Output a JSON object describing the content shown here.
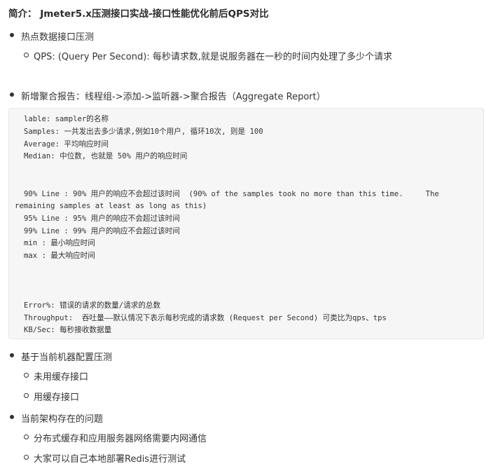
{
  "title": "简介： Jmeter5.x压测接口实战-接口性能优化前后QPS对比",
  "sections": [
    {
      "label": "热点数据接口压测",
      "children": [
        "QPS: (Query Per Second): 每秒请求数,就是说服务器在一秒的时间内处理了多少个请求"
      ]
    },
    {
      "label": "新增聚合报告：线程组->添加->监听器->聚合报告（Aggregate Report）",
      "children": []
    },
    {
      "label": "基于当前机器配置压测",
      "children": [
        "未用缓存接口",
        "用缓存接口"
      ]
    },
    {
      "label": "当前架构存在的问题",
      "children": [
        "分布式缓存和应用服务器网络需要内网通信",
        "大家可以自己本地部署Redis进行测试"
      ]
    }
  ],
  "code": [
    "lable: sampler的名称",
    "Samples: 一共发出去多少请求,例如10个用户, 循环10次, 则是 100",
    "Average: 平均响应时间",
    "Median: 中位数, 也就是 50% 用户的响应时间",
    "90% Line : 90% 用户的响应不会超过该时间  (90% of the samples took no more than this time.     The",
    "remaining samples at least as long as this)",
    "95% Line : 95% 用户的响应不会超过该时间",
    "99% Line : 99% 用户的响应不会超过该时间",
    "min : 最小响应时间",
    "max : 最大响应时间",
    "Error%: 错误的请求的数量/请求的总数",
    "Throughput:  吞吐量——默认情况下表示每秒完成的请求数 (Request per Second) 可类比为qps、tps",
    "KB/Sec: 每秒接收数据量"
  ]
}
